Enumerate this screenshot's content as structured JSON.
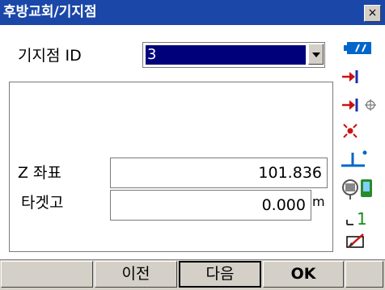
{
  "window": {
    "title": "후방교회/기지점",
    "close_label": "×"
  },
  "base_point": {
    "label": "기지점 ID",
    "selected": "3"
  },
  "z_coord": {
    "label": "Z 좌표",
    "value": "101.836"
  },
  "target_height": {
    "label": "타겟고",
    "value": "0.000",
    "unit": "m"
  },
  "buttons": {
    "prev": "이전",
    "next": "다음",
    "ok": "OK"
  },
  "status_icons": [
    "battery-icon",
    "target-arrow-icon",
    "target-arrow-crosshair-icon",
    "laser-pointer-icon",
    "tilt-level-icon",
    "instrument-icon",
    "edm-mode-icon",
    "input-mode-icon"
  ],
  "colors": {
    "title_bar": "#1a47a8",
    "selection": "#00007a",
    "icon_red": "#cc1111",
    "icon_blue": "#0066cc"
  }
}
